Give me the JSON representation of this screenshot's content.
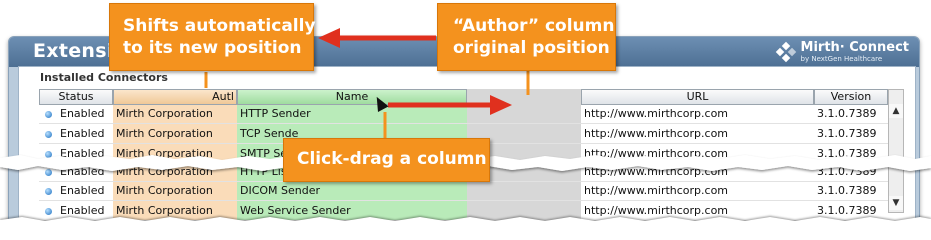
{
  "window": {
    "title": "Extensio"
  },
  "brand": {
    "name": "Mirth· Connect",
    "sub": "by NextGen Healthcare"
  },
  "section": {
    "title": "Installed Connectors"
  },
  "columns": {
    "status": "Status",
    "author": "Autl",
    "name": "Name",
    "url": "URL",
    "version": "Version"
  },
  "rows": [
    {
      "status": "Enabled",
      "author": "Mirth Corporation",
      "name": "HTTP Sender",
      "url": "http://www.mirthcorp.com",
      "version": "3.1.0.7389"
    },
    {
      "status": "Enabled",
      "author": "Mirth Corporation",
      "name": "TCP Sende",
      "url": "http://www.mirthcorp.com",
      "version": "3.1.0.7389"
    },
    {
      "status": "Enabled",
      "author": "Mirth Corporation",
      "name": "SMTP Sen",
      "url": "http://www.mirthcorp.com",
      "version": "3.1.0.7389"
    },
    {
      "status": "Enabled",
      "author": "Mirth Corporation",
      "name": "HTTP List",
      "url": "http://www.mirthcorp.com",
      "version": "3.1.0.7389"
    },
    {
      "status": "Enabled",
      "author": "Mirth Corporation",
      "name": "DICOM Sender",
      "url": "http://www.mirthcorp.com",
      "version": "3.1.0.7389"
    },
    {
      "status": "Enabled",
      "author": "Mirth Corporation",
      "name": "Web Service Sender",
      "url": "http://www.mirthcorp.com",
      "version": "3.1.0.7389"
    }
  ],
  "callouts": {
    "shifts_line1": "Shifts automatically",
    "shifts_line2": "to its new position",
    "author_line1": "“Author” column",
    "author_line2": "original position",
    "drag": "Click-drag a column"
  },
  "colors": {
    "callout": "#f4921e",
    "arrow": "#e0301e",
    "author_col": "#fadcb9",
    "name_col": "#b9ebb9",
    "gap_col": "#d7d7d7"
  }
}
